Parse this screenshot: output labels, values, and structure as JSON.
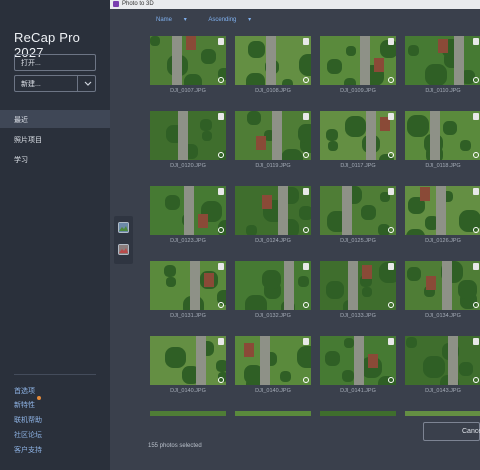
{
  "sidebar": {
    "app_title": "ReCap Pro 2027",
    "open_label": "打开...",
    "new_label": "新建...",
    "nav": [
      {
        "label": "最近",
        "active": true
      },
      {
        "label": "照片项目",
        "active": false
      },
      {
        "label": "学习",
        "active": false
      }
    ],
    "footer_links": [
      "首选项",
      "新特性",
      "联机帮助",
      "社区论坛",
      "客户支持"
    ],
    "colors": {
      "link": "#8fb4e6",
      "badge": "#e58b3a"
    }
  },
  "dialog": {
    "title": "Photo to 3D",
    "sort_field": "Name",
    "sort_order": "Ascending",
    "photos": [
      "DJI_0107.JPG",
      "DJI_0108.JPG",
      "DJI_0109.JPG",
      "DJI_0110.JPG",
      "DJI_0120.JPG",
      "DJI_0119.JPG",
      "DJI_0117.JPG",
      "DJI_0118.JPG",
      "DJI_0123.JPG",
      "DJI_0124.JPG",
      "DJI_0125.JPG",
      "DJI_0126.JPG",
      "DJI_0131.JPG",
      "DJI_0132.JPG",
      "DJI_0133.JPG",
      "DJI_0134.JPG",
      "DJI_0140.JPG",
      "DJI_0140.JPG",
      "DJI_0141.JPG",
      "DJI_0143.JPG"
    ],
    "status_text": "155 photos selected",
    "cancel_label": "Cancel",
    "accent": "#7fb0ef"
  }
}
